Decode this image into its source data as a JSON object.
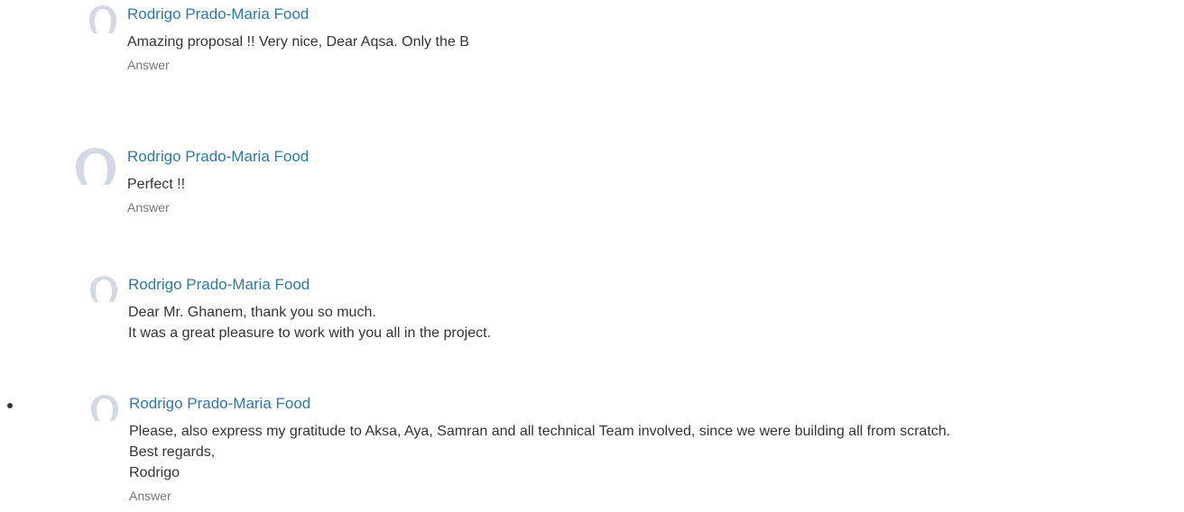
{
  "comments": [
    {
      "author": "Rodrigo Prado-Maria Food",
      "lines": [
        "Amazing proposal !! Very nice, Dear Aqsa. Only the B"
      ],
      "answer_label": "Answer"
    },
    {
      "author": "Rodrigo Prado-Maria Food",
      "lines": [
        "Perfect !!"
      ],
      "answer_label": "Answer"
    },
    {
      "author": "Rodrigo Prado-Maria Food",
      "lines": [
        "Dear Mr. Ghanem, thank you so much.",
        "It was a great pleasure to work with you all in the project."
      ],
      "answer_label": ""
    },
    {
      "author": "Rodrigo Prado-Maria Food",
      "lines": [
        "Please, also express my gratitude to Aksa, Aya, Samran and all technical Team involved, since we were building all from scratch.",
        "Best regards,",
        "Rodrigo"
      ],
      "answer_label": "Answer"
    }
  ],
  "colors": {
    "author_link": "#2f78a8",
    "avatar": "#d3d9e4",
    "text": "#333333",
    "answer": "#777777"
  },
  "icons": {
    "avatar": "user-avatar-placeholder-icon"
  }
}
